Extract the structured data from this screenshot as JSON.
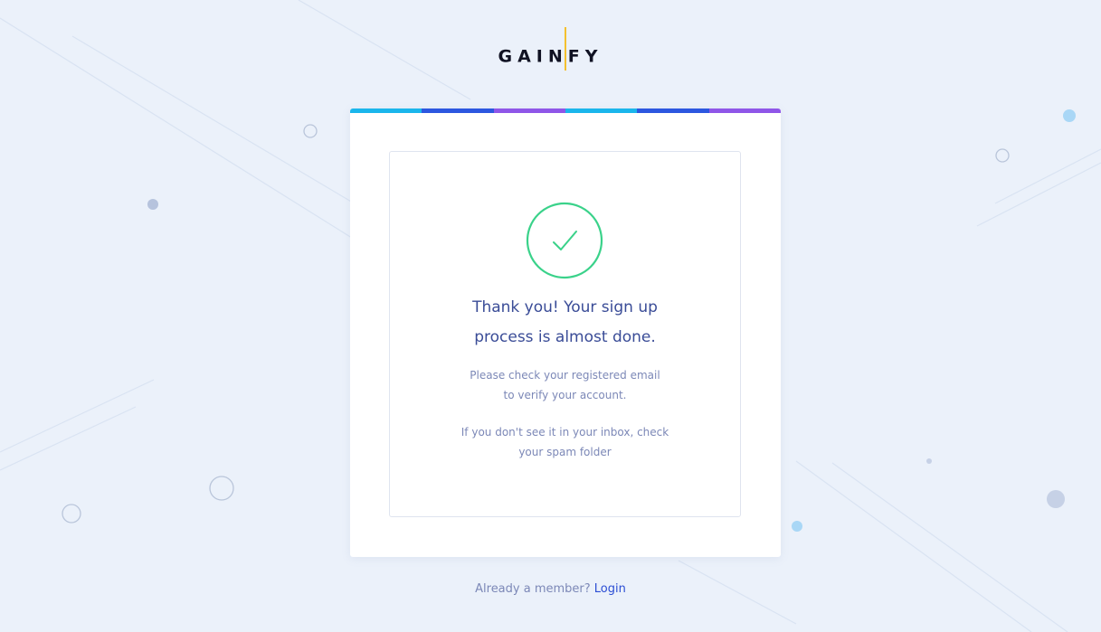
{
  "logo": {
    "text_left": "GAIN",
    "text_right": "FY"
  },
  "colors": {
    "background": "#ebf1fa",
    "stripe": [
      "#1ab6ec",
      "#2c57e0",
      "#8f56e8",
      "#1ab6ec",
      "#2c57e0",
      "#8f56e8"
    ],
    "check": "#3ad28a",
    "headline": "#3a4c97",
    "link": "#2c4ed4"
  },
  "card": {
    "check_icon": "checkmark-circle-icon",
    "headline_line1": "Thank you! Your sign up",
    "headline_line2": "process is almost done.",
    "message_line1": "Please check your registered email",
    "message_line2": "to verify your account.",
    "note_line1": "If you don't see it in your inbox, check",
    "note_line2": "your spam folder"
  },
  "footer": {
    "prompt": "Already a member?",
    "login_label": "Login"
  }
}
